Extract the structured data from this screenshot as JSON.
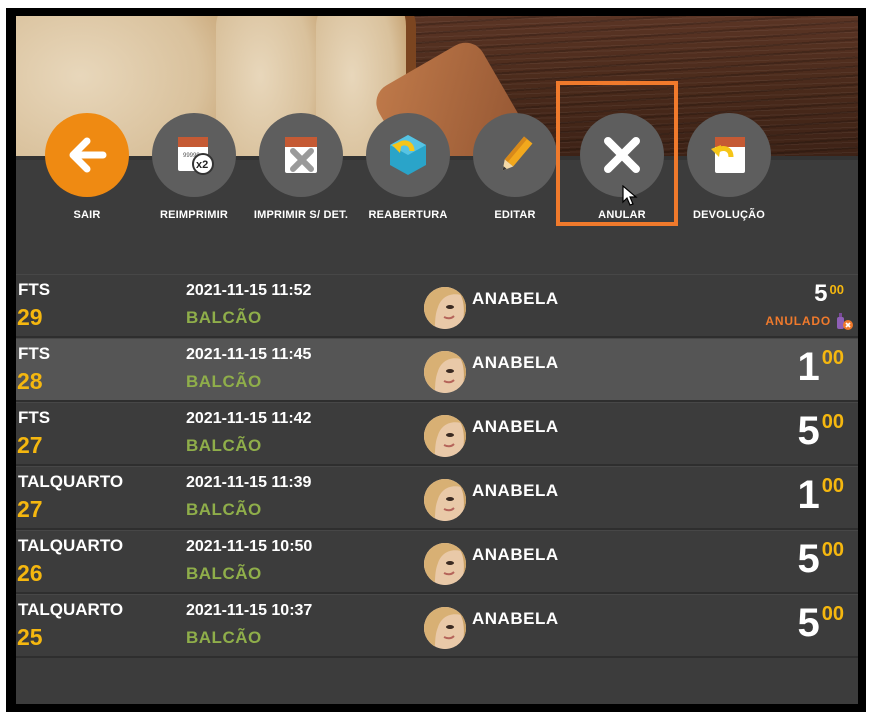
{
  "toolbar": {
    "buttons": [
      {
        "label": "SAIR",
        "icon": "arrow-left-icon"
      },
      {
        "label": "REIMPRIMIR",
        "icon": "reprint-x2-icon",
        "badge": "x2"
      },
      {
        "label": "IMPRIMIR S/ DET.",
        "icon": "print-no-detail-icon"
      },
      {
        "label": "REABERTURA",
        "icon": "reopen-icon"
      },
      {
        "label": "EDITAR",
        "icon": "pencil-icon"
      },
      {
        "label": "ANULAR",
        "icon": "close-icon"
      },
      {
        "label": "DEVOLUÇÃO",
        "icon": "return-icon"
      }
    ]
  },
  "rows": [
    {
      "type": "FTS",
      "number": "29",
      "datetime": "2021-11-15 11:52",
      "place": "BALCÃO",
      "user": "ANABELA",
      "price_int": "5",
      "price_dec": "00",
      "status": "ANULADO"
    },
    {
      "type": "FTS",
      "number": "28",
      "datetime": "2021-11-15 11:45",
      "place": "BALCÃO",
      "user": "ANABELA",
      "price_int": "1",
      "price_dec": "00"
    },
    {
      "type": "FTS",
      "number": "27",
      "datetime": "2021-11-15 11:42",
      "place": "BALCÃO",
      "user": "ANABELA",
      "price_int": "5",
      "price_dec": "00"
    },
    {
      "type": "TALQUARTO",
      "number": "27",
      "datetime": "2021-11-15 11:39",
      "place": "BALCÃO",
      "user": "ANABELA",
      "price_int": "1",
      "price_dec": "00"
    },
    {
      "type": "TALQUARTO",
      "number": "26",
      "datetime": "2021-11-15 10:50",
      "place": "BALCÃO",
      "user": "ANABELA",
      "price_int": "5",
      "price_dec": "00"
    },
    {
      "type": "TALQUARTO",
      "number": "25",
      "datetime": "2021-11-15 10:37",
      "place": "BALCÃO",
      "user": "ANABELA",
      "price_int": "5",
      "price_dec": "00"
    }
  ],
  "colors": {
    "accent_orange": "#ef8a12",
    "highlight_box": "#f07a2c",
    "number_yellow": "#f5b70f",
    "place_green": "#8fae4a",
    "background": "#3c3c3c",
    "selected_row": "#555555"
  }
}
